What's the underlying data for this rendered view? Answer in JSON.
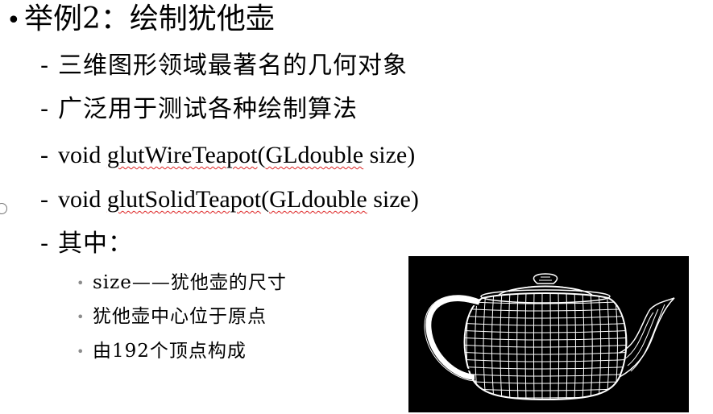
{
  "title": {
    "bullet": "•",
    "text": "举例2：绘制犹他壶"
  },
  "items": [
    {
      "dash": "-",
      "text": "三维图形领域最著名的几何对象"
    },
    {
      "dash": "-",
      "text": "广泛用于测试各种绘制算法"
    },
    {
      "dash": "-",
      "prefix": "void ",
      "func": "glutWireTeapot",
      "paren_open": "(",
      "type": "GLdouble",
      "rest": " size)"
    },
    {
      "dash": "-",
      "prefix": "void ",
      "func": "glutSolidTeapot",
      "paren_open": "(",
      "type": "GLdouble",
      "rest": " size)"
    },
    {
      "dash": "-",
      "text": "其中："
    }
  ],
  "details": [
    {
      "bullet": "•",
      "text": "size——犹他壶的尺寸"
    },
    {
      "bullet": "•",
      "text": "犹他壶中心位于原点"
    },
    {
      "bullet": "•",
      "text": "由192个顶点构成"
    }
  ],
  "figure": {
    "description_icon": "wireframe-teapot-icon",
    "background": "#000000",
    "line_color": "#ffffff"
  }
}
